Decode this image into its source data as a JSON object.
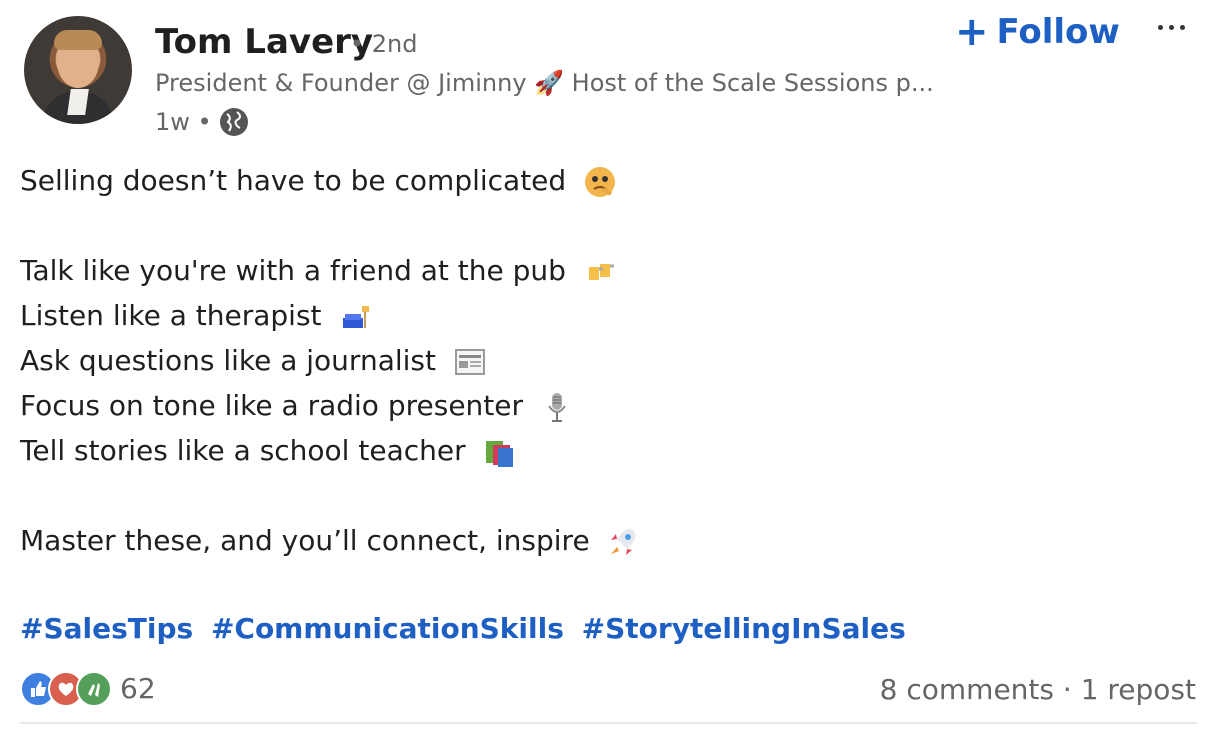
{
  "post": {
    "author": "Tom Lavery",
    "degree": "• 2nd",
    "headline": "President & Founder @ Jiminny 🚀 Host of the Scale Sessions p...",
    "time": "1w •",
    "follow_label": "Follow",
    "content_lines": [
      "Selling doesn’t have to be complicated",
      "Talk like you're with a friend at the pub",
      "Listen like a therapist",
      "Ask questions like a journalist",
      "Focus on tone like a radio presenter",
      "Tell stories like a school teacher",
      "Master these, and you’ll connect, inspire"
    ],
    "hashtags": [
      "#SalesTips",
      "#CommunicationSkills",
      "#StorytellingInSales"
    ],
    "reaction_count": "62",
    "engagement": "8 comments · 1 repost"
  },
  "icons": [
    "globe-icon",
    "more-icon",
    "thinking-face-icon",
    "beer-mugs-icon",
    "couch-lamp-icon",
    "newspaper-icon",
    "microphone-icon",
    "books-icon",
    "rocket-icon",
    "like-reaction-icon",
    "love-reaction-icon",
    "celebrate-reaction-icon"
  ],
  "colors": {
    "accent": "#1d5fc3",
    "text": "#1f1f1f",
    "muted": "#666666"
  }
}
